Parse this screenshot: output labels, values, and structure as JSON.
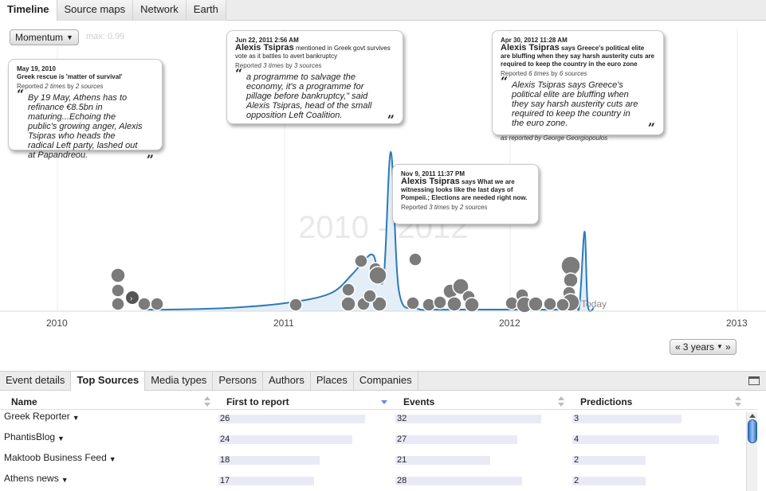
{
  "top_tabs": [
    {
      "label": "Timeline",
      "active": true
    },
    {
      "label": "Source maps",
      "active": false
    },
    {
      "label": "Network",
      "active": false
    },
    {
      "label": "Earth",
      "active": false
    }
  ],
  "controls": {
    "metric_select": "Momentum",
    "max_label": "max: 0.99",
    "range_button": "3 years",
    "range_prev": "«",
    "range_next": "»"
  },
  "timeline": {
    "watermark": "2010 - 2012",
    "today_label": "Today",
    "year_labels": [
      "2010",
      "2011",
      "2012",
      "2013"
    ],
    "colors": {
      "curve": "#2a7ab8",
      "fill": "#e4eef7",
      "bubble": "#7b7b7b",
      "bubble_stroke": "#ffffff"
    }
  },
  "chart_data": {
    "type": "area",
    "x_axis": [
      "2010",
      "2011",
      "2012",
      "2013"
    ],
    "series": [
      {
        "name": "",
        "x": [
          "2010-05-15",
          "2010-07-01",
          "2010-10-01",
          "2011-01-01",
          "2011-03-15",
          "2011-04-20",
          "2011-05-10",
          "2011-05-25",
          "2011-06-10",
          "2011-06-22",
          "2011-07-05",
          "2011-08-01",
          "2011-09-01",
          "2011-10-15",
          "2011-12-01",
          "2012-01-15",
          "2012-03-15",
          "2012-04-15",
          "2012-04-22",
          "2012-04-30",
          "2012-05-05",
          "2012-05-15"
        ],
        "y": [
          0.0,
          0.0,
          0.01,
          0.04,
          0.1,
          0.22,
          0.31,
          0.34,
          0.19,
          0.99,
          0.12,
          0.01,
          0.0,
          0.0,
          0.0,
          0.0,
          0.0,
          0.01,
          0.04,
          0.49,
          0.03,
          0.01
        ]
      }
    ]
  },
  "callouts": [
    {
      "date": "May 19, 2010",
      "headline_person": "",
      "headline_rest": "Greek rescue is 'matter of survival'",
      "reported_pre": "Reported",
      "reported_times": "2 times",
      "reported_by": "by",
      "reported_sources": "2 sources",
      "quote": "By 19 May, Athens has to refinance €8.5bn in maturing...Echoing the public's growing anger, Alexis Tsipras who heads the radical Left party, lashed out at Papandreou.",
      "attribution": ""
    },
    {
      "date": "Jun 22, 2011 2:56 AM",
      "headline_person": "Alexis Tsipras",
      "headline_rest": "mentioned in Greek govt survives vote as it battles to avert bankruptcy",
      "reported_pre": "Reported",
      "reported_times": "3 times",
      "reported_by": "by",
      "reported_sources": "3 sources",
      "quote": "a programme to salvage the economy, it's a programme for pillage before bankruptcy,\" said Alexis Tsipras, head of the small opposition Left Coalition.",
      "attribution": ""
    },
    {
      "date": "Nov 9, 2011 11:37 PM",
      "headline_person": "Alexis Tsipras",
      "headline_rest": "says What we are witnessing looks like the last days of Pompeii.; Elections are needed right now.",
      "reported_pre": "Reported",
      "reported_times": "3 times",
      "reported_by": "by",
      "reported_sources": "2 sources",
      "quote": "",
      "attribution": ""
    },
    {
      "date": "Apr 30, 2012 11:28 AM",
      "headline_person": "Alexis Tsipras",
      "headline_rest": "says Greece's political elite are bluffing when they say harsh austerity cuts are required to keep the country in the euro zone",
      "reported_pre": "Reported",
      "reported_times": "6 times",
      "reported_by": "by",
      "reported_sources": "6 sources",
      "quote": "Alexis Tsipras says Greece's political elite are bluffing when they say harsh austerity cuts are required to keep the country in the euro zone.",
      "attribution": "as reported by George Georgiopoulos"
    }
  ],
  "bottom_tabs": [
    {
      "label": "Event details",
      "active": false
    },
    {
      "label": "Top Sources",
      "active": true
    },
    {
      "label": "Media types",
      "active": false
    },
    {
      "label": "Persons",
      "active": false
    },
    {
      "label": "Authors",
      "active": false
    },
    {
      "label": "Places",
      "active": false
    },
    {
      "label": "Companies",
      "active": false
    }
  ],
  "table": {
    "columns": [
      "Name",
      "First to report",
      "Events",
      "Predictions"
    ],
    "sorted_column": "First to report",
    "rows": [
      {
        "name": "Greek Reporter",
        "first": 26,
        "events": 32,
        "predictions": 3
      },
      {
        "name": "PhantisBlog",
        "first": 24,
        "events": 27,
        "predictions": 4
      },
      {
        "name": "Maktoob Business Feed",
        "first": 18,
        "events": 21,
        "predictions": 2
      },
      {
        "name": "Athens news",
        "first": 17,
        "events": 28,
        "predictions": 2
      }
    ]
  }
}
